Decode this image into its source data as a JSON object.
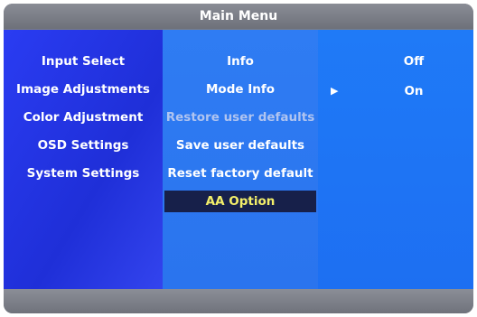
{
  "title": "Main Menu",
  "left_menu": {
    "items": [
      {
        "label": "Input Select"
      },
      {
        "label": "Image Adjustments"
      },
      {
        "label": "Color Adjustment"
      },
      {
        "label": "OSD Settings"
      },
      {
        "label": "System Settings"
      }
    ]
  },
  "middle_menu": {
    "items": [
      {
        "label": "Info",
        "state": "normal"
      },
      {
        "label": "Mode Info",
        "state": "normal"
      },
      {
        "label": "Restore user defaults",
        "state": "disabled"
      },
      {
        "label": "Save user defaults",
        "state": "normal"
      },
      {
        "label": "Reset factory default",
        "state": "normal"
      },
      {
        "label": "AA Option",
        "state": "selected"
      }
    ]
  },
  "right_options": {
    "items": [
      {
        "label": "Off",
        "marker": ""
      },
      {
        "label": "On",
        "marker": "▶"
      }
    ]
  },
  "colors": {
    "selected_text": "#f3ef6a",
    "selected_bg": "#17204a",
    "disabled_text": "#b0c4f0"
  }
}
